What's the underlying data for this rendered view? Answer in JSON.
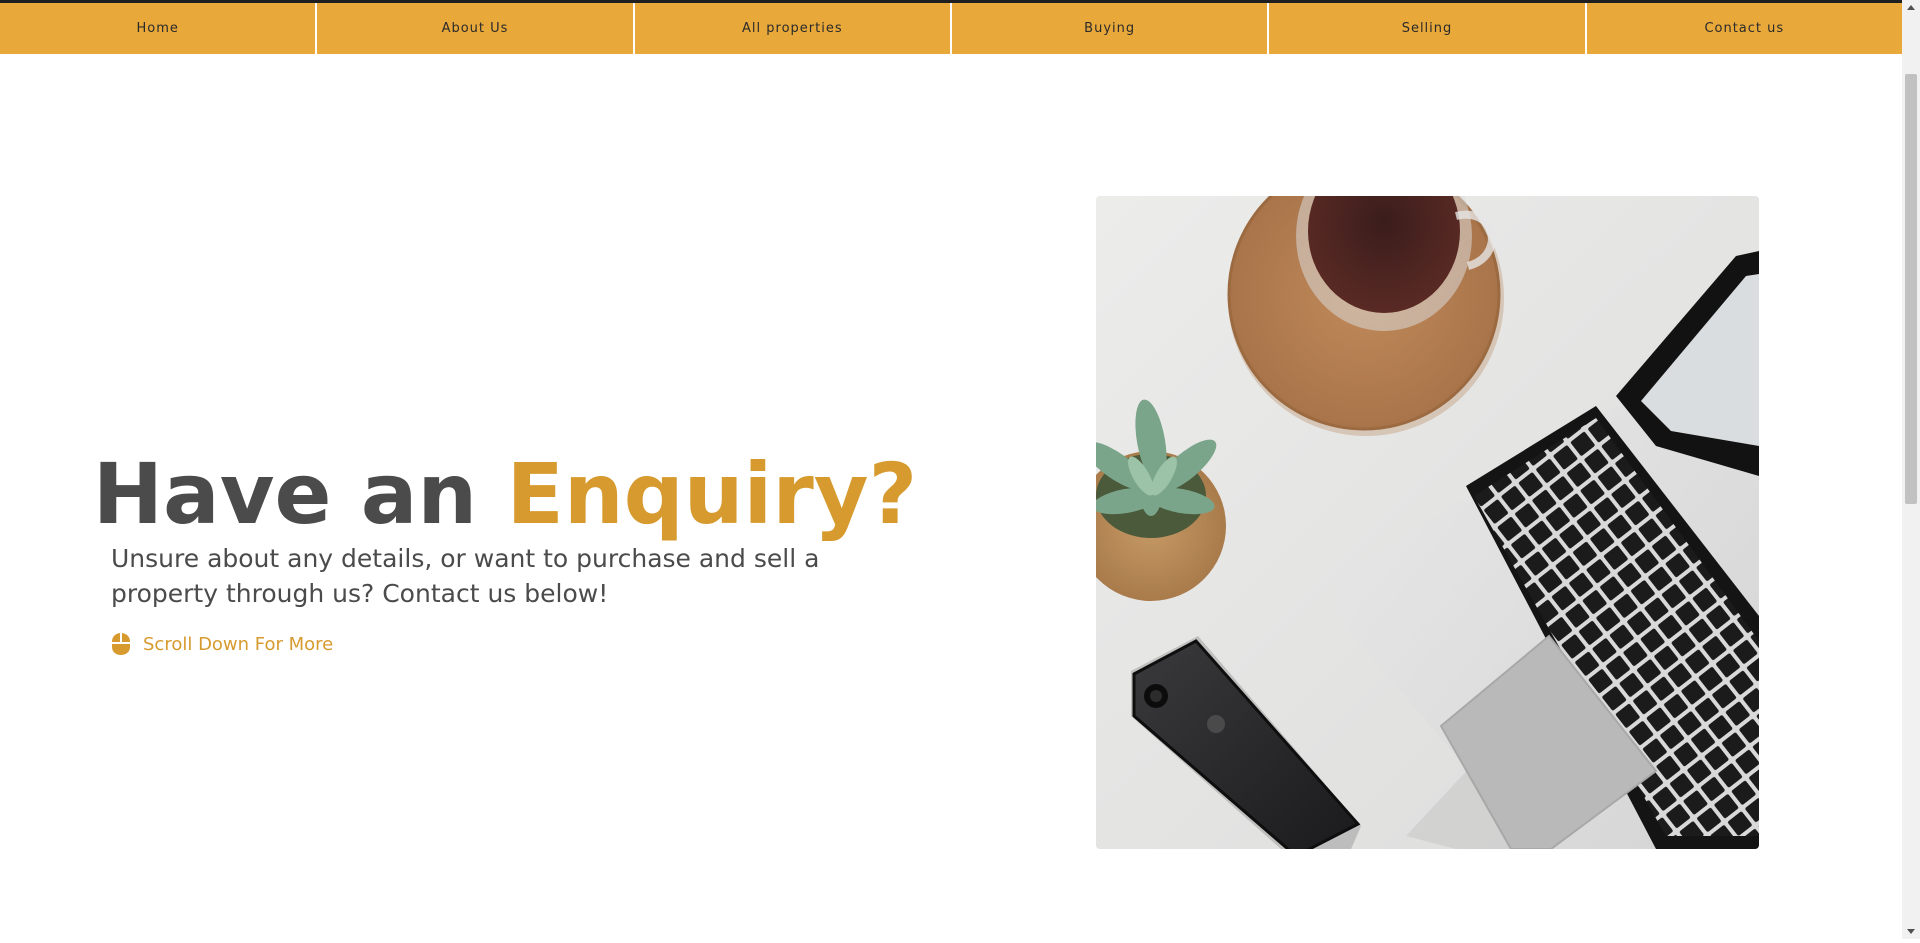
{
  "nav": {
    "items": [
      {
        "label": "Home"
      },
      {
        "label": "About Us"
      },
      {
        "label": "All properties"
      },
      {
        "label": "Buying"
      },
      {
        "label": "Selling"
      },
      {
        "label": "Contact us"
      }
    ]
  },
  "hero": {
    "title_plain": "Have an ",
    "title_accent": "Enquiry?",
    "description": "Unsure about any details, or want to purchase and sell a property through us? Contact us below!",
    "scroll_label": "Scroll Down For More",
    "scroll_icon": "mouse-icon"
  },
  "colors": {
    "accent": "#e8a83a",
    "accent_text": "#d79a2e",
    "heading": "#4b4b4b",
    "background": "#ffffff"
  }
}
